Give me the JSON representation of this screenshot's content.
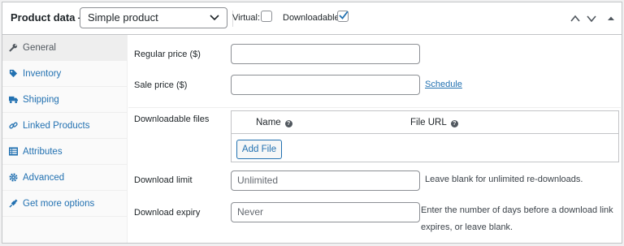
{
  "header": {
    "title": "Product data —",
    "product_type": "Simple product",
    "virtual_label": "Virtual:",
    "virtual_checked": false,
    "downloadable_label": "Downloadable:",
    "downloadable_checked": true
  },
  "sidebar": {
    "items": [
      {
        "label": "General",
        "icon": "wrench-icon",
        "active": true
      },
      {
        "label": "Inventory",
        "icon": "tag-icon"
      },
      {
        "label": "Shipping",
        "icon": "truck-icon"
      },
      {
        "label": "Linked Products",
        "icon": "link-icon"
      },
      {
        "label": "Attributes",
        "icon": "list-icon"
      },
      {
        "label": "Advanced",
        "icon": "gear-icon"
      },
      {
        "label": "Get more options",
        "icon": "plugin-icon"
      }
    ]
  },
  "general": {
    "regular_price_label": "Regular price ($)",
    "regular_price_value": "",
    "sale_price_label": "Sale price ($)",
    "sale_price_value": "",
    "schedule_link": "Schedule",
    "downloadable_files_label": "Downloadable files",
    "files_col_name": "Name",
    "files_col_url": "File URL",
    "add_file_button": "Add File",
    "download_limit_label": "Download limit",
    "download_limit_placeholder": "Unlimited",
    "download_limit_hint": "Leave blank for unlimited re-downloads.",
    "download_expiry_label": "Download expiry",
    "download_expiry_placeholder": "Never",
    "download_expiry_hint_line1": "Enter the number of days before a download link",
    "download_expiry_hint_line2": "expires, or leave blank."
  },
  "colors": {
    "link": "#2271b1",
    "border": "#c3c4c7",
    "sidebar_bg": "#fafafa",
    "active_tab_bg": "#eeeeee"
  }
}
